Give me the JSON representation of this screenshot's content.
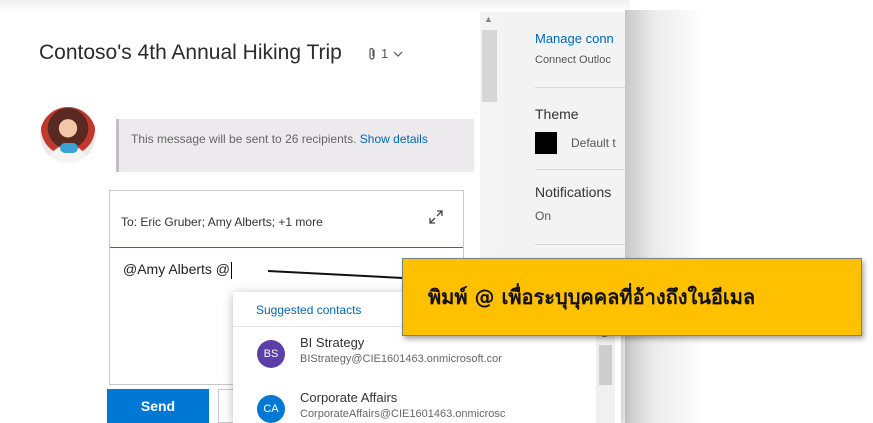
{
  "message": {
    "subject": "Contoso's 4th Annual Hiking Trip",
    "attachment_count": "1",
    "notice_text": "This message will be sent to 26 recipients.",
    "notice_link": "Show details"
  },
  "compose": {
    "to_label": "To:",
    "recipients": "Eric Gruber; Amy Alberts; +1 more",
    "mention": "@Amy Alberts",
    "typed": "@"
  },
  "actions": {
    "send_label": "Send",
    "discard_label": "D"
  },
  "suggestions": {
    "header": "Suggested contacts",
    "contacts": [
      {
        "initials": "BS",
        "name": "BI Strategy",
        "email": "BIStrategy@CIE1601463.onmicrosoft.cor",
        "color": "#5c3ea8"
      },
      {
        "initials": "CA",
        "name": "Corporate Affairs",
        "email": "CorporateAffairs@CIE1601463.onmicrosc",
        "color": "#0078d4"
      }
    ]
  },
  "settings": {
    "manage_link": "Manage conn",
    "manage_sub": "Connect Outloc",
    "theme_title": "Theme",
    "theme_value": "Default t",
    "notifications_title": "Notifications",
    "notifications_value": "On"
  },
  "callout": {
    "text": "พิมพ์ @ เพื่อระบุบุคคลที่อ้างถึงในอีเมล",
    "color": "#ffc000"
  },
  "colors": {
    "accent": "#0078d4",
    "link": "#0067b8"
  }
}
